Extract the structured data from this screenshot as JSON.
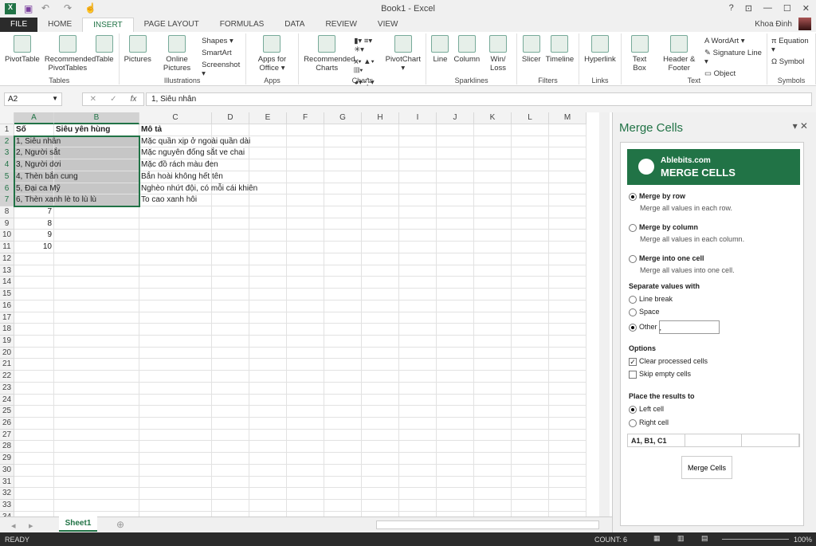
{
  "window": {
    "title": "Book1 - Excel",
    "user": "Khoa Đinh",
    "controls": [
      "?",
      "⊡",
      "—",
      "☐",
      "✕"
    ]
  },
  "tabs": [
    {
      "label": "FILE"
    },
    {
      "label": "HOME"
    },
    {
      "label": "INSERT",
      "active": true
    },
    {
      "label": "PAGE LAYOUT"
    },
    {
      "label": "FORMULAS"
    },
    {
      "label": "DATA"
    },
    {
      "label": "REVIEW"
    },
    {
      "label": "VIEW"
    }
  ],
  "ribbon": [
    {
      "label": "Tables",
      "buttons": [
        "PivotTable",
        "Recommended PivotTables",
        "Table"
      ],
      "small": []
    },
    {
      "label": "Illustrations",
      "buttons": [
        "Pictures",
        "Online Pictures"
      ],
      "small": [
        "Shapes ▾",
        "SmartArt",
        "Screenshot ▾"
      ]
    },
    {
      "label": "Apps",
      "buttons": [
        "Apps for Office ▾"
      ],
      "small": []
    },
    {
      "label": "Charts",
      "buttons": [
        "Recommended Charts"
      ],
      "small": [
        "▮▾  ≡▾  ✳▾",
        "⩙▾  ▲▾  ▥▾",
        "◕▾  ⁛▾"
      ],
      "buttons2": [
        "PivotChart ▾"
      ]
    },
    {
      "label": "Sparklines",
      "buttons": [
        "Line",
        "Column",
        "Win/ Loss"
      ],
      "small": []
    },
    {
      "label": "Filters",
      "buttons": [
        "Slicer",
        "Timeline"
      ],
      "small": []
    },
    {
      "label": "Links",
      "buttons": [
        "Hyperlink"
      ],
      "small": []
    },
    {
      "label": "Text",
      "buttons": [
        "Text Box",
        "Header & Footer"
      ],
      "small": [
        "A WordArt ▾",
        "✎ Signature Line ▾",
        "▭ Object"
      ]
    },
    {
      "label": "Symbols",
      "buttons": [],
      "small": [
        "π Equation ▾",
        "Ω Symbol"
      ]
    }
  ],
  "formula_bar": {
    "name_box": "A2",
    "fx": "fx",
    "cancel": "✕",
    "enter": "✓",
    "value": "1, Siêu nhân"
  },
  "sheet": {
    "columns": [
      "A",
      "B",
      "C",
      "D",
      "E",
      "F",
      "G",
      "H",
      "I",
      "J",
      "K",
      "L",
      "M"
    ],
    "selected_columns": [
      "A",
      "B"
    ],
    "selected_rows": [
      2,
      3,
      4,
      5,
      6,
      7
    ],
    "row_count": 34,
    "cells": {
      "A1": "Số",
      "B1": "Siêu yên hùng",
      "C1": "Mô tả",
      "A2": "1, Siêu nhân",
      "C2": "Mặc quần xịp ở ngoài quần dài",
      "A3": "2, Người sắt",
      "C3": "Mặc nguyên đống sắt ve chai",
      "A4": "3, Người dơi",
      "C4": "Mặc đồ rách màu đen",
      "A5": "4, Thèn bắn cung",
      "C5": "Bắn hoài không hết tên",
      "A6": "5, Đại ca Mỹ",
      "C6": "Nghèo nhứt đội, có mỗi cái khiên",
      "A7": "6, Thèn xanh lè to lù lù",
      "C7": "To cao xanh hôi",
      "A8": "7",
      "A9": "8",
      "A10": "9",
      "A11": "10"
    },
    "tab": "Sheet1"
  },
  "status": {
    "ready": "READY",
    "count": "COUNT: 6",
    "zoom": "100%"
  },
  "pane": {
    "title": "Merge Cells",
    "brand": "Ablebits.com",
    "product": "MERGE CELLS",
    "modes": [
      {
        "label": "Merge by row",
        "desc": "Merge all values in each row.",
        "checked": true
      },
      {
        "label": "Merge by column",
        "desc": "Merge all values in each column.",
        "checked": false
      },
      {
        "label": "Merge into one cell",
        "desc": "Merge all values into one cell.",
        "checked": false
      }
    ],
    "separator_heading": "Separate values with",
    "separators": [
      {
        "label": "Line break",
        "checked": false
      },
      {
        "label": "Space",
        "checked": false
      },
      {
        "label": "Other",
        "checked": true
      }
    ],
    "other_value": ",",
    "options_heading": "Options",
    "options": [
      {
        "label": "Clear processed cells",
        "checked": true
      },
      {
        "label": "Skip empty cells",
        "checked": false
      }
    ],
    "place_heading": "Place the results to",
    "places": [
      {
        "label": "Left cell",
        "checked": true
      },
      {
        "label": "Right cell",
        "checked": false
      }
    ],
    "preview": [
      "A1, B1, C1",
      "",
      ""
    ],
    "merge_button": "Merge Cells"
  },
  "colors": {
    "accent": "#217346"
  }
}
